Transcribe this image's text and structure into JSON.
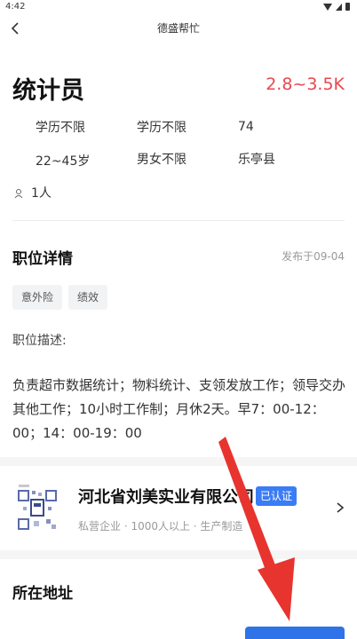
{
  "status_bar": {
    "time": "4:42"
  },
  "nav": {
    "title": "德盛帮忙"
  },
  "job": {
    "title": "统计员",
    "salary": "2.8~3.5K",
    "attributes": [
      "学历不限",
      "学历不限",
      "74",
      "22~45岁",
      "男女不限",
      "乐亭县"
    ],
    "headcount": "1人"
  },
  "details": {
    "section_title": "职位详情",
    "publish_date": "发布于09-04",
    "tags": [
      "意外险",
      "绩效"
    ],
    "description_label": "职位描述:",
    "description": "负责超市数据统计；物料统计、支领发放工作；领导交办其他工作；10小时工作制；月休2天。早7：00-12：00；14：00-19：00"
  },
  "company": {
    "name": "河北省刘美实业有限公司",
    "badge": "已认证",
    "meta": "私营企业 · 1000人以上 · 生产制造"
  },
  "location": {
    "section_title": "所在地址"
  },
  "overlay": {
    "arrow_color": "#e8342f"
  }
}
